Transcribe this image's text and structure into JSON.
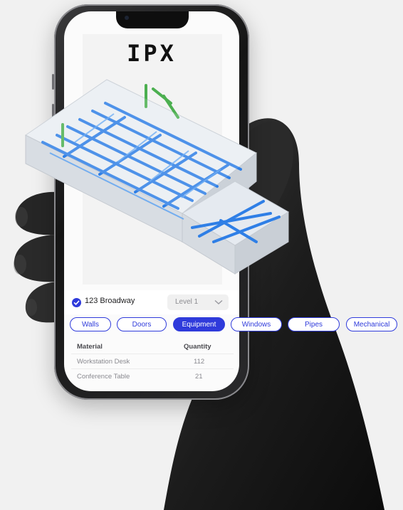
{
  "app": {
    "logo_text": "IPX"
  },
  "project": {
    "address": "123 Broadway",
    "level_selected": "Level 1"
  },
  "tabs": [
    {
      "label": "Walls",
      "active": false
    },
    {
      "label": "Doors",
      "active": false
    },
    {
      "label": "Equipment",
      "active": true
    },
    {
      "label": "Windows",
      "active": false
    },
    {
      "label": "Pipes",
      "active": false
    },
    {
      "label": "Mechanical",
      "active": false
    }
  ],
  "table": {
    "headers": [
      "Material",
      "Quantity"
    ],
    "rows": [
      [
        "Workstation Desk",
        "112"
      ],
      [
        "Conference Table",
        "21"
      ]
    ]
  },
  "colors": {
    "accent": "#2f3bdb",
    "pipes": "#2f7fe6",
    "green_pipes": "#4caf50",
    "background": "#f1f1f1"
  }
}
